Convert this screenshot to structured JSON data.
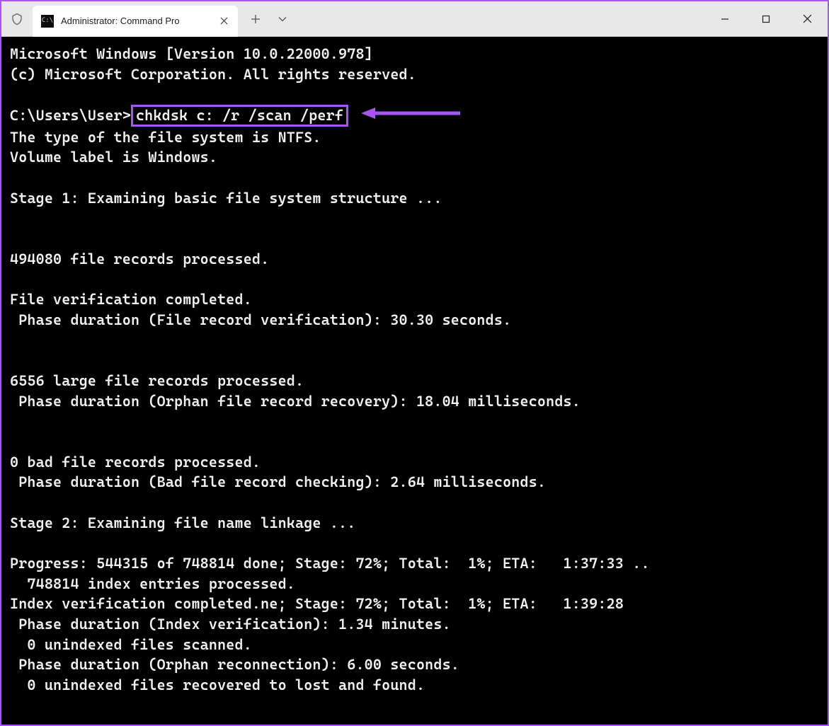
{
  "window": {
    "tab_title": "Administrator: Command Pro"
  },
  "terminal": {
    "line_version": "Microsoft Windows [Version 10.0.22000.978]",
    "line_copyright": "(c) Microsoft Corporation. All rights reserved.",
    "prompt": "C:\\Users\\User>",
    "command": "chkdsk c: /r /scan /perf",
    "line_fs": "The type of the file system is NTFS.",
    "line_vol": "Volume label is Windows.",
    "line_stage1": "Stage 1: Examining basic file system structure ...",
    "line_filerec": "494080 file records processed.",
    "line_fverify": "File verification completed.",
    "line_phase1": " Phase duration (File record verification): 30.30 seconds.",
    "line_large": "6556 large file records processed.",
    "line_phase2": " Phase duration (Orphan file record recovery): 18.04 milliseconds.",
    "line_bad": "0 bad file records processed.",
    "line_phase3": " Phase duration (Bad file record checking): 2.64 milliseconds.",
    "line_stage2": "Stage 2: Examining file name linkage ...",
    "line_progress": "Progress: 544315 of 748814 done; Stage: 72%; Total:  1%; ETA:   1:37:33 ..",
    "line_index": "  748814 index entries processed.",
    "line_idxver": "Index verification completed.ne; Stage: 72%; Total:  1%; ETA:   1:39:28",
    "line_phase4": " Phase duration (Index verification): 1.34 minutes.",
    "line_unidx1": "  0 unindexed files scanned.",
    "line_phase5": " Phase duration (Orphan reconnection): 6.00 seconds.",
    "line_unidx2": "  0 unindexed files recovered to lost and found."
  },
  "annotation": {
    "highlight_color": "#a855f7"
  }
}
